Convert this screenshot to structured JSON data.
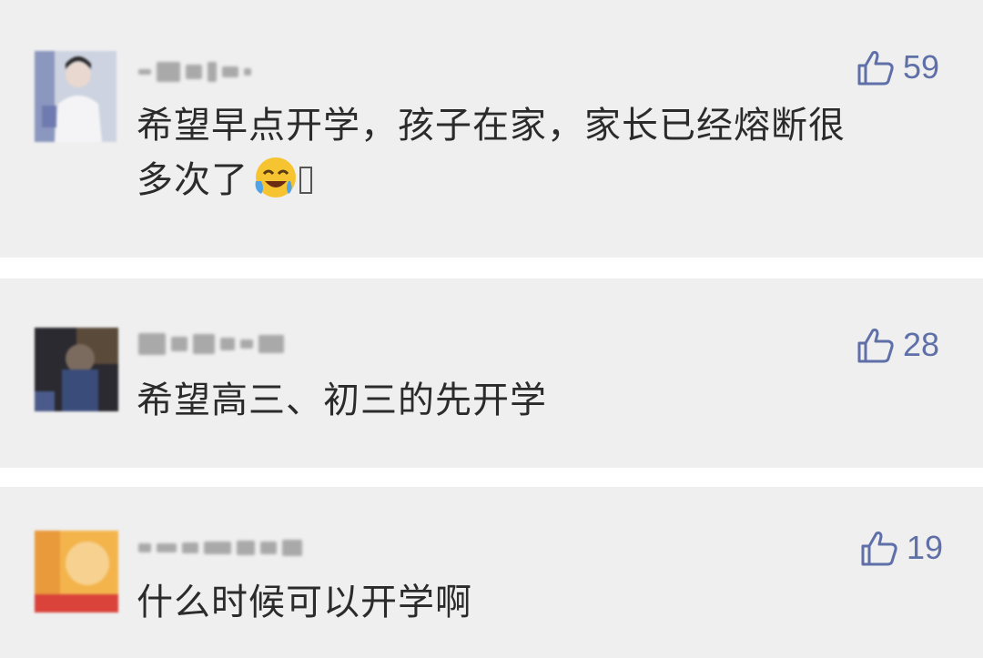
{
  "comments": [
    {
      "likes": "59",
      "text_line1": "希望早点开学，孩子在家，家长已经熔断很",
      "text_line2": "多次了",
      "emoji": "laughing-crying-emoji"
    },
    {
      "likes": "28",
      "text": "希望高三、初三的先开学"
    },
    {
      "likes": "19",
      "text": "什么时候可以开学啊"
    }
  ],
  "icons": {
    "like": "thumbs-up-icon"
  },
  "colors": {
    "card_background": "#efefef",
    "separator": "#ffffff",
    "like_accent": "#5f6fa8",
    "text": "#2b2b2b"
  }
}
